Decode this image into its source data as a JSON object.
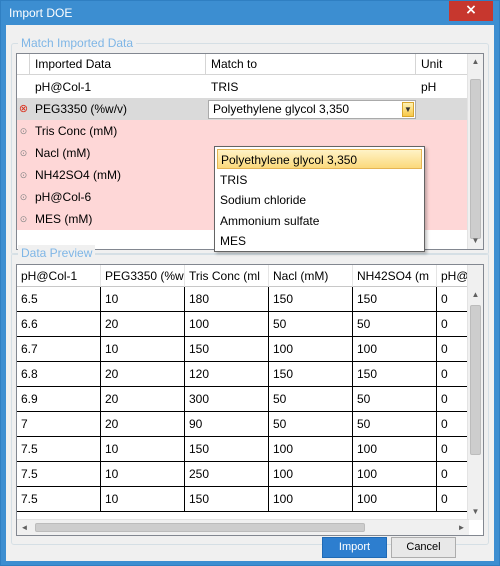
{
  "window": {
    "title": "Import DOE",
    "close_glyph": "×"
  },
  "match_group": {
    "title": "Match Imported Data",
    "columns": [
      "Imported Data",
      "Match to",
      "Unit"
    ],
    "rows": [
      {
        "imported": "pH@Col-1",
        "match": "TRIS",
        "unit": "pH",
        "status": "none"
      },
      {
        "imported": "PEG3350 (%w/v)",
        "match": "Polyethylene glycol 3,350",
        "unit": "",
        "status": "error"
      },
      {
        "imported": "Tris Conc (mM)",
        "match": "",
        "unit": "",
        "status": "unmatched"
      },
      {
        "imported": "Nacl (mM)",
        "match": "",
        "unit": "",
        "status": "unmatched"
      },
      {
        "imported": "NH42SO4 (mM)",
        "match": "",
        "unit": "",
        "status": "unmatched"
      },
      {
        "imported": "pH@Col-6",
        "match": "",
        "unit": "",
        "status": "unmatched"
      },
      {
        "imported": "MES (mM)",
        "match": "",
        "unit": "",
        "status": "unmatched"
      }
    ],
    "dropdown": {
      "options": [
        "Polyethylene glycol 3,350",
        "TRIS",
        "Sodium chloride",
        "Ammonium sulfate",
        "MES"
      ],
      "highlighted": "Polyethylene glycol 3,350"
    }
  },
  "preview_group": {
    "title": "Data Preview",
    "columns": [
      "pH@Col-1",
      "PEG3350 (%w",
      "Tris Conc (ml",
      "Nacl (mM)",
      "NH42SO4 (m",
      "pH@"
    ],
    "rows": [
      [
        "6.5",
        "10",
        "180",
        "150",
        "150",
        "0"
      ],
      [
        "6.6",
        "20",
        "100",
        "50",
        "50",
        "0"
      ],
      [
        "6.7",
        "10",
        "150",
        "100",
        "100",
        "0"
      ],
      [
        "6.8",
        "20",
        "120",
        "150",
        "150",
        "0"
      ],
      [
        "6.9",
        "20",
        "300",
        "50",
        "50",
        "0"
      ],
      [
        "7",
        "20",
        "90",
        "50",
        "50",
        "0"
      ],
      [
        "7.5",
        "10",
        "150",
        "100",
        "100",
        "0"
      ],
      [
        "7.5",
        "10",
        "250",
        "100",
        "100",
        "0"
      ],
      [
        "7.5",
        "10",
        "150",
        "100",
        "100",
        "0"
      ]
    ]
  },
  "buttons": {
    "import": "Import",
    "cancel": "Cancel"
  },
  "colors": {
    "accent": "#3c8ed1",
    "error": "#d9321f",
    "unmatched_row": "#fed7d7",
    "highlight": "#fbd97c"
  }
}
